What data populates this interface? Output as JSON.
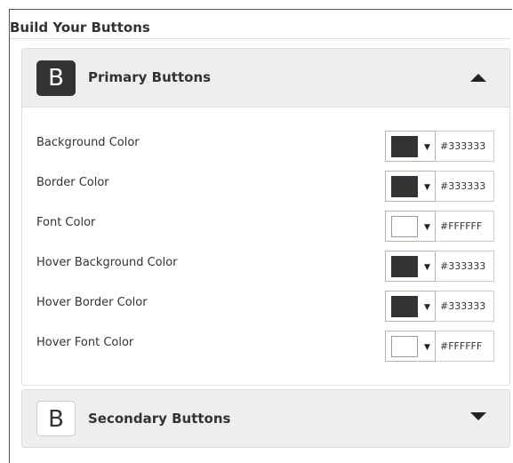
{
  "section_title": "Build Your Buttons",
  "primary": {
    "badge": "B",
    "title": "Primary Buttons",
    "expanded": true,
    "rows": [
      {
        "label": "Background Color",
        "hex": "#333333",
        "swatch": "#333333"
      },
      {
        "label": "Border Color",
        "hex": "#333333",
        "swatch": "#333333"
      },
      {
        "label": "Font Color",
        "hex": "#FFFFFF",
        "swatch": "#FFFFFF"
      },
      {
        "label": "Hover Background Color",
        "hex": "#333333",
        "swatch": "#333333"
      },
      {
        "label": "Hover Border Color",
        "hex": "#333333",
        "swatch": "#333333"
      },
      {
        "label": "Hover Font Color",
        "hex": "#FFFFFF",
        "swatch": "#FFFFFF"
      }
    ]
  },
  "secondary": {
    "badge": "B",
    "title": "Secondary Buttons",
    "expanded": false
  },
  "icons": {
    "primary_toggle": "caret-up-icon",
    "secondary_toggle": "caret-down-icon",
    "dropdown": "triangle-down-icon"
  },
  "dropdown_glyph": "▼"
}
